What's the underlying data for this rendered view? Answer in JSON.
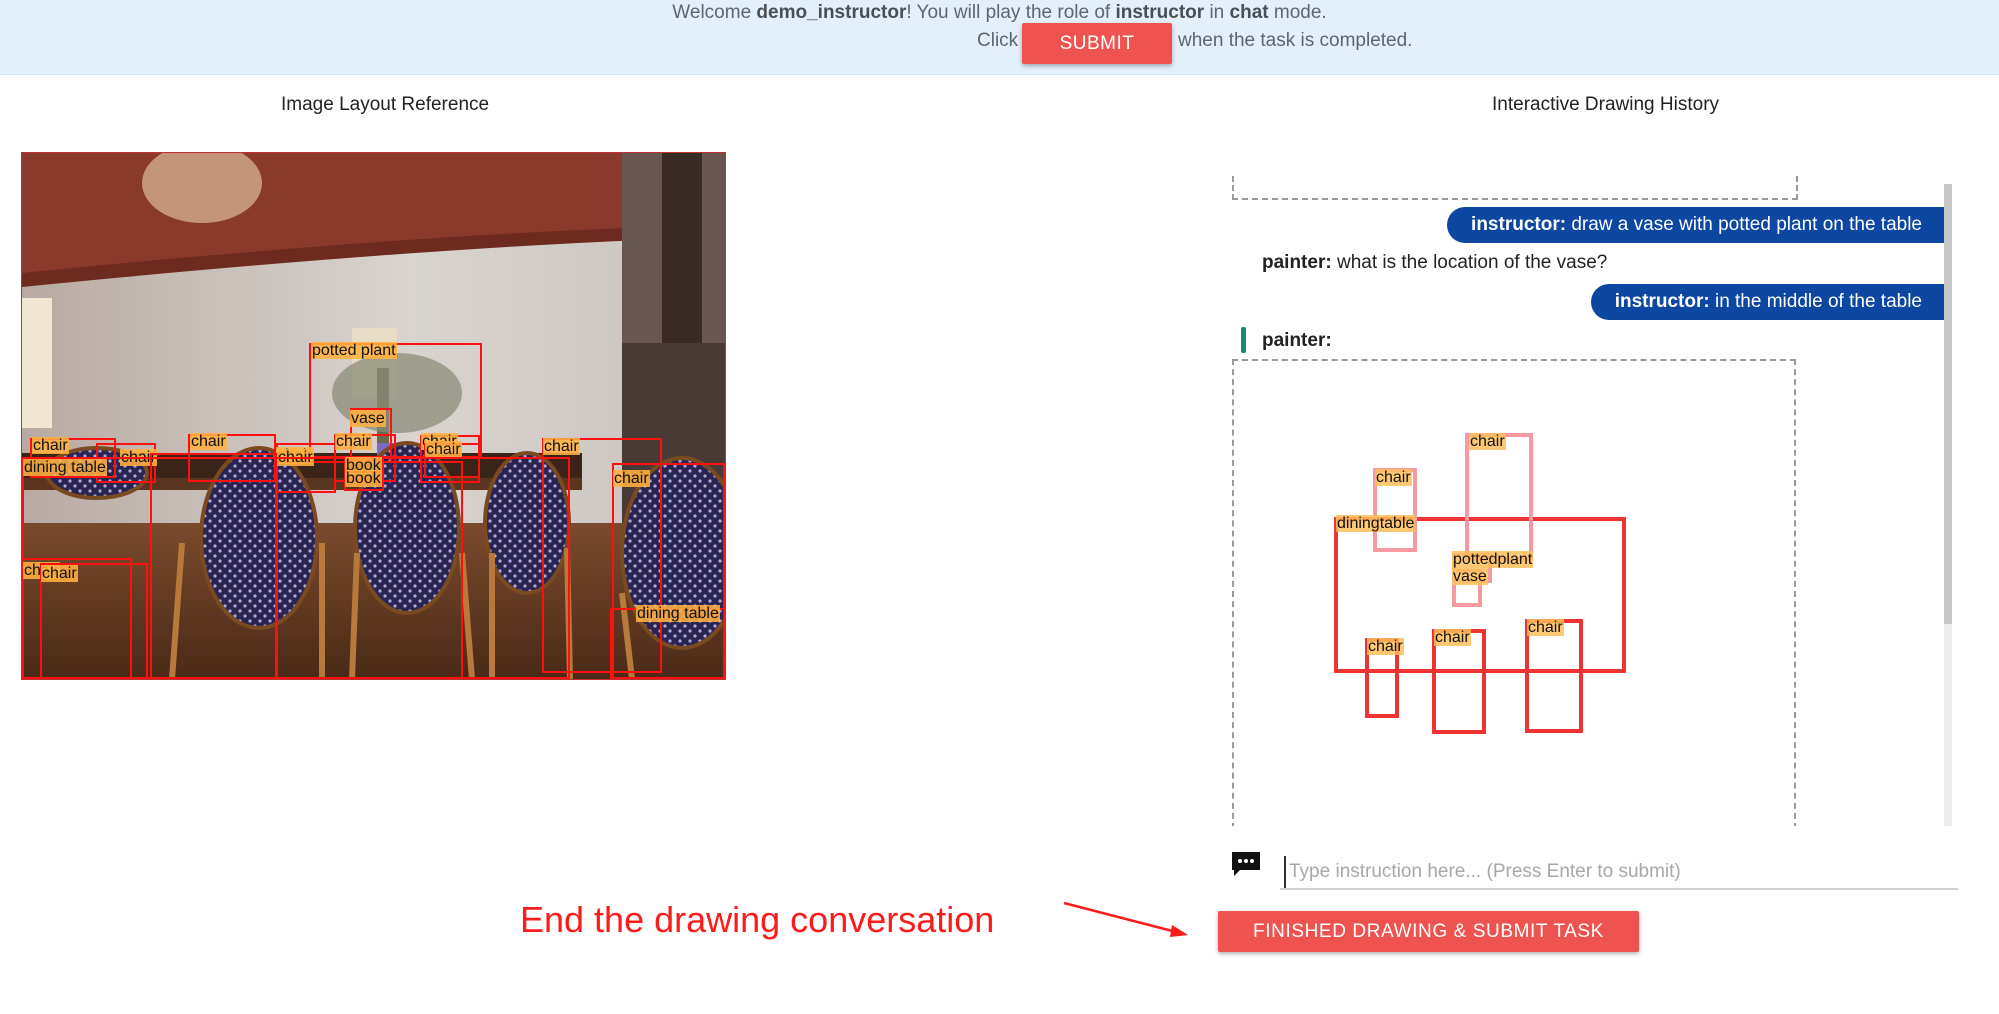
{
  "header": {
    "welcome_prefix": "Welcome ",
    "username": "demo_instructor",
    "welcome_middle": "! You will play the role of ",
    "role": "instructor",
    "welcome_in": " in ",
    "mode": "chat",
    "welcome_suffix": " mode.",
    "click_label": "Click",
    "submit_label": "SUBMIT",
    "completed_text": "when the task is completed."
  },
  "left": {
    "title": "Image Layout Reference",
    "image_icon": "dining-room-photo",
    "annotations": [
      {
        "label": "potted plant"
      },
      {
        "label": "vase"
      },
      {
        "label": "chair"
      },
      {
        "label": "chair"
      },
      {
        "label": "chair"
      },
      {
        "label": "chair"
      },
      {
        "label": "chair"
      },
      {
        "label": "chair"
      },
      {
        "label": "chair"
      },
      {
        "label": "chair"
      },
      {
        "label": "chair"
      },
      {
        "label": "chair"
      },
      {
        "label": "dining table"
      },
      {
        "label": "book"
      },
      {
        "label": "book"
      },
      {
        "label": "chair"
      },
      {
        "label": "chair"
      },
      {
        "label": "dining table"
      }
    ]
  },
  "right": {
    "title": "Interactive Drawing History",
    "messages": [
      {
        "speaker": "instructor:",
        "text": " draw a vase with potted plant on the table"
      },
      {
        "speaker": "painter:",
        "text": " what is the location of the vase?"
      },
      {
        "speaker": "instructor:",
        "text": " in the middle of the table"
      },
      {
        "speaker": "painter:",
        "text": ""
      }
    ],
    "canvas_labels": [
      "chair",
      "chair",
      "diningtable",
      "pottedplant",
      "vase",
      "chair",
      "chair",
      "chair"
    ],
    "input_placeholder": "Type instruction here... (Press Enter to submit)",
    "input_value": ""
  },
  "footer": {
    "annotation": "End the drawing conversation",
    "finish_label": "FINISHED DRAWING & SUBMIT TASK"
  },
  "colors": {
    "header_bg": "#e3effa",
    "accent_red": "#ef5350",
    "instructor_bubble": "#0d47a1",
    "box_red": "#ff1010",
    "label_orange": "#ffb040",
    "annotation_red": "#ff1a1a"
  },
  "icons": [
    "chat-bubble-icon",
    "arrow-annotation-icon"
  ]
}
